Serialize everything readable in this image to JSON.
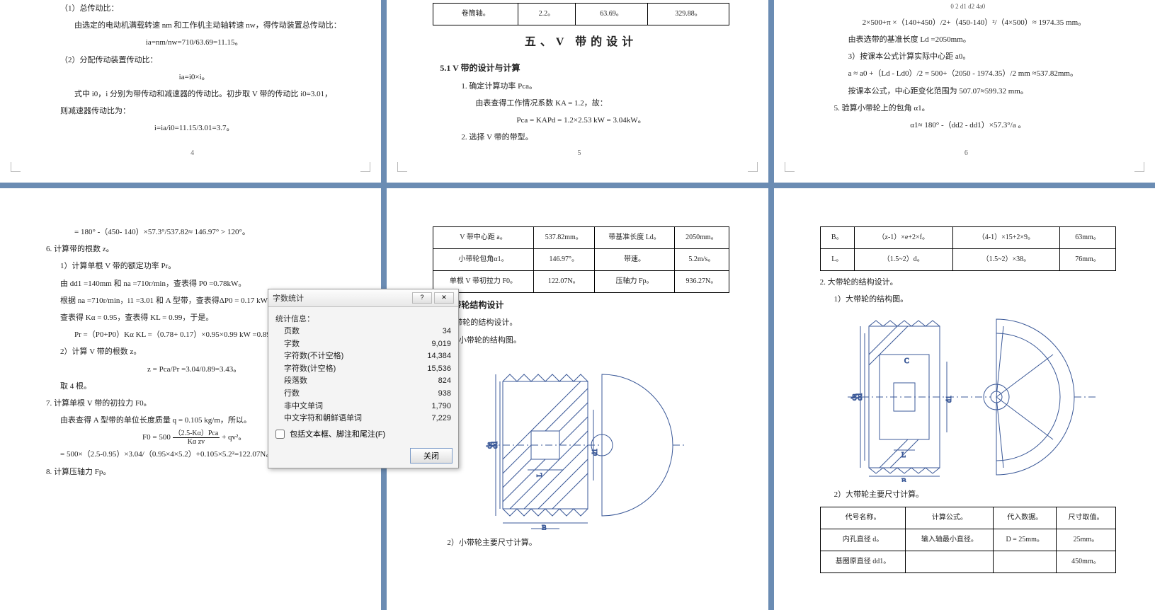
{
  "p1": {
    "l1": "（1）总传动比：",
    "l2": "由选定的电动机满载转速 nm 和工作机主动轴转速 nw，得传动装置总传动比：",
    "l3": "ia=nm/nw=710/63.69=11.15。",
    "l4": "（2）分配传动装置传动比：",
    "l5": "ia=i0×i。",
    "l6": "式中 i0，i 分别为带传动和减速器的传动比。初步取 V 带的传动比 i0=3.01，",
    "l7": "则减速器传动比为：",
    "l8": "i=ia/i0=11.15/3.01=3.7。",
    "pnum": "4"
  },
  "p2": {
    "tbl": {
      "r1": [
        "卷筒轴。",
        "2.2。",
        "63.69。",
        "329.88。"
      ]
    },
    "h": "五、V 带的设计",
    "s1": "5.1 V 带的设计与计算",
    "l1": "1. 确定计算功率 Pca。",
    "l2": "由表查得工作情况系数 KA = 1.2，故：",
    "l3": "Pca = KAPd = 1.2×2.53 kW = 3.04kW。",
    "l4": "2. 选择 V 带的带型。",
    "pnum": "5"
  },
  "p3": {
    "l0": "0   2   d1  d2                4a0",
    "l1": "2×500+π ×（140+450）/2+（450-140）²/（4×500）≈ 1974.35 mm。",
    "l2": "由表选带的基准长度 Ld =2050mm。",
    "l3": "3）按课本公式计算实际中心距 a0。",
    "l4": "a ≈ a0 +（Ld - Ld0）/2 = 500+（2050 - 1974.35）/2 mm ≈537.82mm。",
    "l5": "按课本公式，中心距变化范围为 507.07≈599.32 mm。",
    "l6": "5. 验算小带轮上的包角 α1。",
    "l7": "α1≈ 180° -（dd2 - dd1）×57.3°/a 。",
    "pnum": "6"
  },
  "p4": {
    "l1": "= 180° -（450- 140）×57.3°/537.82≈ 146.97° > 120°。",
    "l2": "6. 计算带的根数 z。",
    "l3": "1）计算单根 V 带的额定功率 Pr。",
    "l4": "由 dd1 =140mm 和 na =710r/min，查表得 P0 =0.78kW。",
    "l5": "根据 na =710r/min，i1 =3.01 和 A 型带，查表得ΔP0 = 0.17 kW。",
    "l6": "查表得 Kα  = 0.95，查表得 KL = 0.99，于是。",
    "l7": "Pr =（P0+P0）Kα  KL =（0.78+ 0.17）×0.95×0.99 kW =0.89kW。",
    "l8": "2）计算 V 带的根数 z。",
    "l9": "z = Pca/Pr =3.04/0.89=3.43。",
    "l10": "取 4 根。",
    "l11": "7. 计算单根 V 带的初拉力 F0。",
    "l12": "由表查得 A 型带的单位长度质量 q = 0.105 kg/m，所以。",
    "fracTop": "（2.5-Kα）Pca",
    "fracBot": "Kα zv",
    "l13a": "F0 = 500",
    "l13b": "+ qv²。",
    "l14": "= 500×（2.5-0.95）×3.04/（0.95×4×5.2）+0.105×5.2²=122.07N。",
    "l15": "8. 计算压轴力 Fp。"
  },
  "p5": {
    "tbl": {
      "r1": [
        "V 带中心距 a。",
        "537.82mm。",
        "带基准长度 Ld。",
        "2050mm。"
      ],
      "r2": [
        "小带轮包角α1。",
        "146.97°。",
        "带速。",
        "5.2m/s。"
      ],
      "r3": [
        "单根 V 带初拉力 F0。",
        "122.07N。",
        "压轴力 Fp。",
        "936.27N。"
      ]
    },
    "h": "5.2 带轮结构设计",
    "l1": "小带轮的结构设计。",
    "l2": "1）小带轮的结构图。",
    "l3": "2）小带轮主要尺寸计算。"
  },
  "p6": {
    "tbl1": {
      "r1": [
        "B。",
        "（z-1）×e+2×f。",
        "（4-1）×15+2×9。",
        "63mm。"
      ],
      "r2": [
        "L。",
        "（1.5~2）d。",
        "（1.5~2）×38。",
        "76mm。"
      ]
    },
    "l1": "2. 大带轮的结构设计。",
    "l2": "1）大带轮的结构图。",
    "l3": "2）大带轮主要尺寸计算。",
    "tbl2": {
      "h": [
        "代号名称。",
        "计算公式。",
        "代入数据。",
        "尺寸取值。"
      ],
      "r1": [
        "内孔直径 d。",
        "输入轴最小直径。",
        "D = 25mm。",
        "25mm。"
      ],
      "r2": [
        "基圈原直径 dd1。",
        "",
        "",
        "450mm。"
      ]
    }
  },
  "dialog": {
    "title": "字数统计",
    "help": "?",
    "close": "✕",
    "hdr": "统计信息：",
    "rows": [
      {
        "k": "页数",
        "v": "34"
      },
      {
        "k": "字数",
        "v": "9,019"
      },
      {
        "k": "字符数(不计空格)",
        "v": "14,384"
      },
      {
        "k": "字符数(计空格)",
        "v": "15,536"
      },
      {
        "k": "段落数",
        "v": "824"
      },
      {
        "k": "行数",
        "v": "938"
      },
      {
        "k": "非中文单词",
        "v": "1,790"
      },
      {
        "k": "中文字符和朝鲜语单词",
        "v": "7,229"
      }
    ],
    "chk": "包括文本框、脚注和尾注(F)",
    "btn": "关闭"
  }
}
